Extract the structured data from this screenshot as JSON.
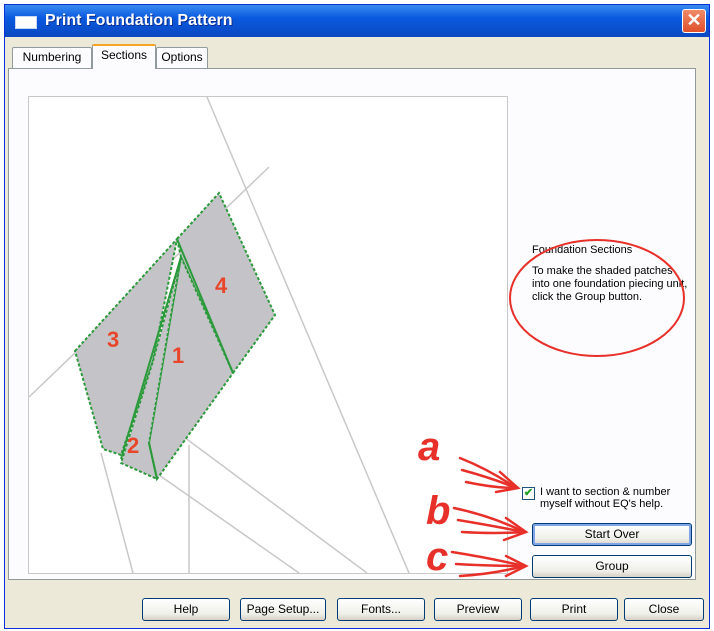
{
  "window": {
    "title": "Print Foundation Pattern",
    "close_glyph": "✕"
  },
  "tabs": [
    {
      "label": "Numbering",
      "active": false
    },
    {
      "label": "Sections",
      "active": true
    },
    {
      "label": "Options",
      "active": false
    }
  ],
  "canvas": {
    "patch_labels": [
      "1",
      "2",
      "3",
      "4"
    ],
    "patch_fill": "#c4c4c8",
    "seam_color": "#2a9a3a",
    "label_color": "#e8462a"
  },
  "info": {
    "heading": "Foundation Sections",
    "body": "To make the shaded patches into one foundation piecing unit, click the Group button."
  },
  "checkbox": {
    "label": "I want to section & number myself without EQ's help.",
    "checked": true
  },
  "side_buttons": {
    "start_over": "Start Over",
    "group": "Group"
  },
  "bottom_buttons": [
    "Help",
    "Page Setup...",
    "Fonts...",
    "Preview",
    "Print",
    "Close"
  ],
  "annotations": {
    "a": "a",
    "b": "b",
    "c": "c",
    "color": "#e8302a"
  }
}
